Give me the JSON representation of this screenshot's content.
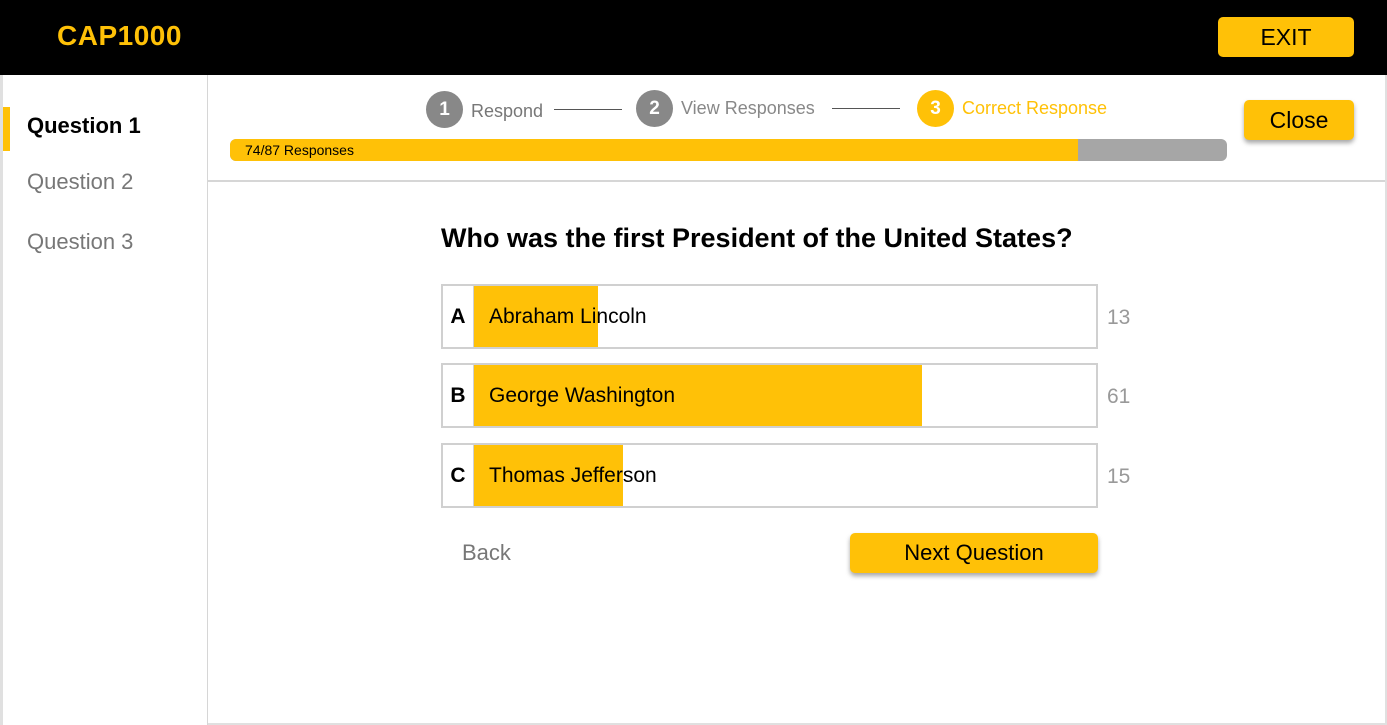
{
  "app": {
    "title": "CAP1000",
    "exit_label": "EXIT"
  },
  "colors": {
    "accent": "#FFC107",
    "header_bg": "#000000",
    "muted_text": "#777777",
    "count_text": "#999999",
    "progress_track": "#a6a6a6"
  },
  "sidebar": {
    "items": [
      {
        "label": "Question 1",
        "active": true
      },
      {
        "label": "Question 2",
        "active": false
      },
      {
        "label": "Question 3",
        "active": false
      }
    ]
  },
  "steps": [
    {
      "number": "1",
      "label": "Respond",
      "state": "done"
    },
    {
      "number": "2",
      "label": "View Responses",
      "state": "done"
    },
    {
      "number": "3",
      "label": "Correct Response",
      "state": "current"
    }
  ],
  "progress": {
    "label": "74/87 Responses",
    "responded": 74,
    "total": 87
  },
  "close_label": "Close",
  "question": {
    "text": "Who was the first President of the United States?"
  },
  "answers": [
    {
      "letter": "A",
      "text": "Abraham Lincoln",
      "count": "13",
      "fraction": 0.2
    },
    {
      "letter": "B",
      "text": "George Washington",
      "count": "61",
      "fraction": 0.72
    },
    {
      "letter": "C",
      "text": "Thomas Jefferson",
      "count": "15",
      "fraction": 0.24
    }
  ],
  "nav": {
    "back_label": "Back",
    "next_label": "Next Question"
  }
}
